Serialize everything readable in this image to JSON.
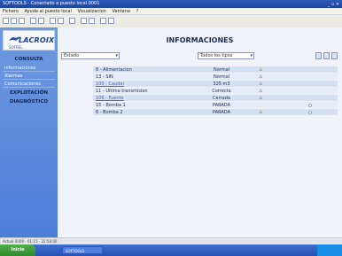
{
  "window": {
    "title": "SOFTOOLS - Conectado a puesto local 0001",
    "controls": "_ ▫ ×"
  },
  "menu": [
    "Fichero",
    "Ayuda al puesto local",
    "Visualizacion",
    "Ventana",
    "?"
  ],
  "brand": {
    "logo_text": "LACROIX",
    "logo_sub": "SOFREL"
  },
  "sidebar": {
    "sections": [
      {
        "label": "CONSULTA",
        "items": [
          "Informaciones",
          "Alarmas",
          "Comunicaciones"
        ]
      },
      {
        "label": "EXPLOTACIÓN",
        "items": []
      },
      {
        "label": "DIAGNÓSTICO",
        "items": []
      }
    ]
  },
  "main": {
    "title": "INFORMACIONES",
    "filter_estado": "Estado",
    "filter_tipos": "Todos los tipos",
    "rows": [
      {
        "name": "8 - Alimentacion",
        "value": "Normal",
        "warn": true,
        "dot": false
      },
      {
        "name": "13 - SIN",
        "value": "Normal",
        "warn": true,
        "dot": false
      },
      {
        "name": "100 - Caudal",
        "value": "325 m3",
        "warn": true,
        "dot": false,
        "link": true
      },
      {
        "name": "11 - Ultima transmision",
        "value": "Correcta",
        "warn": true,
        "dot": false
      },
      {
        "name": "106 - Fuente",
        "value": "Cerrada",
        "warn": true,
        "dot": false,
        "link": true
      },
      {
        "name": "15 - Bomba 1",
        "value": "PARADA",
        "warn": false,
        "dot": true
      },
      {
        "name": "6 - Bomba 2",
        "value": "PARADA",
        "warn": true,
        "dot": true
      }
    ]
  },
  "statusbar": "Actual 0000 - 01:15 - 22:58:00",
  "taskbar": {
    "start": "Inicio",
    "task": "SOFTOOLS"
  },
  "icons": [
    "new-icon",
    "open-icon",
    "save-icon",
    "print-icon",
    "cut-icon",
    "copy-icon",
    "paste-icon",
    "help-icon",
    "connect-icon",
    "refresh-icon",
    "settings-icon",
    "export-icon"
  ]
}
